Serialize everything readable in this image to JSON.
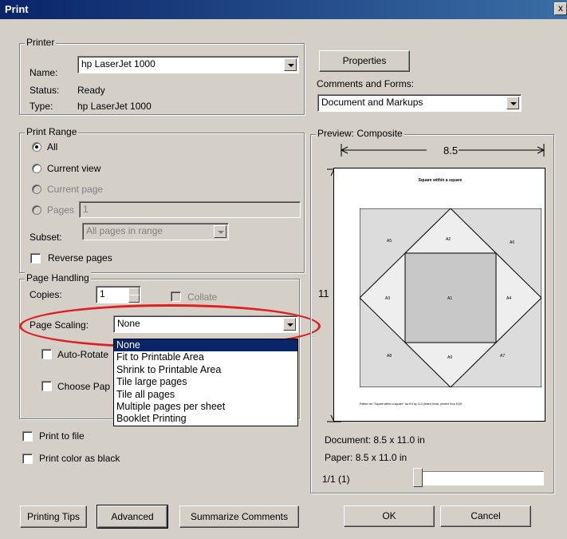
{
  "window": {
    "title": "Print",
    "close_glyph": "x"
  },
  "printer": {
    "group_label": "Printer",
    "name_label": "Name:",
    "name_value": "hp LaserJet 1000",
    "status_label": "Status:",
    "status_value": "Ready",
    "type_label": "Type:",
    "type_value": "hp LaserJet 1000",
    "properties_button": "Properties",
    "comments_label": "Comments and Forms:",
    "comments_value": "Document and Markups"
  },
  "print_range": {
    "group_label": "Print Range",
    "all": "All",
    "current_view": "Current view",
    "current_page": "Current page",
    "pages": "Pages",
    "pages_value": "1",
    "subset_label": "Subset:",
    "subset_value": "All pages in range",
    "reverse_pages": "Reverse pages"
  },
  "page_handling": {
    "group_label": "Page Handling",
    "copies_label": "Copies:",
    "copies_value": "1",
    "collate": "Collate",
    "scaling_label": "Page Scaling:",
    "scaling_value": "None",
    "auto_rotate": "Auto-Rotate",
    "choose_paper": "Choose Pap",
    "scaling_options": [
      "None",
      "Fit to Printable Area",
      "Shrink to Printable Area",
      "Tile large pages",
      "Tile all pages",
      "Multiple pages per sheet",
      "Booklet Printing"
    ]
  },
  "options": {
    "print_to_file": "Print to file",
    "print_color_black": "Print color as black"
  },
  "preview": {
    "group_label": "Preview: Composite",
    "width_label": "8.5",
    "height_label": "11",
    "page_title": "Square within a square",
    "block_labels": [
      "A2",
      "A5",
      "A6",
      "A1",
      "A3",
      "A4",
      "A8",
      "A7",
      "A9"
    ],
    "page_footer": "Pattern for \"Square within a square\" via 8.5 by 11.0 (letter) block, printed from EQ5",
    "document_size": "Document: 8.5 x 11.0 in",
    "paper_size": "Paper: 8.5 x 11.0 in",
    "page_counter": "1/1 (1)"
  },
  "buttons": {
    "printing_tips": "Printing Tips",
    "advanced": "Advanced",
    "summarize_comments": "Summarize Comments",
    "ok": "OK",
    "cancel": "Cancel"
  },
  "colors": {
    "titlebar": "#0a246a",
    "highlight": "#0a246a",
    "annotation": "#e02020",
    "face": "#d4d0c8"
  }
}
